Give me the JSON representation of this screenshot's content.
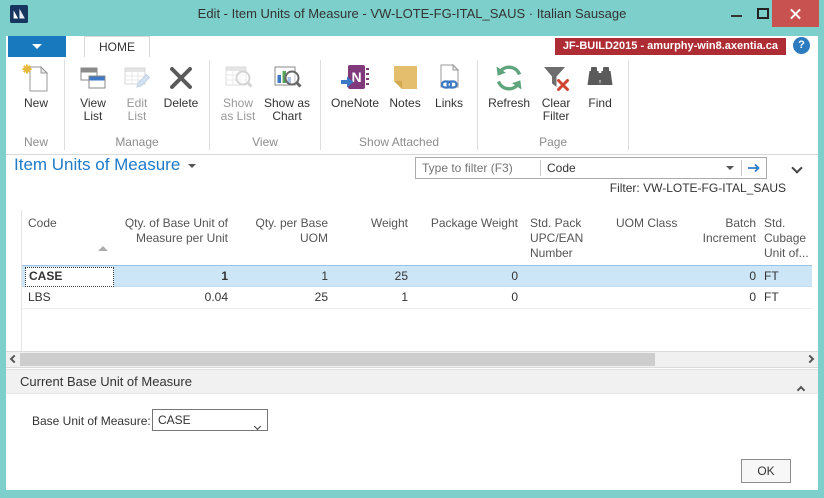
{
  "window": {
    "title": "Edit - Item Units of Measure - VW-LOTE-FG-ITAL_SAUS · Italian Sausage"
  },
  "tabbar": {
    "home_tab": "HOME",
    "server_badge": "JF-BUILD2015 - amurphy-win8.axentia.ca",
    "help_glyph": "?"
  },
  "ribbon": {
    "groups": [
      {
        "label": "New",
        "buttons": [
          {
            "label": "New",
            "icon": "new-icon",
            "enabled": true
          }
        ]
      },
      {
        "label": "Manage",
        "buttons": [
          {
            "label": "View\nList",
            "icon": "view-list-icon",
            "enabled": true
          },
          {
            "label": "Edit\nList",
            "icon": "edit-list-icon",
            "enabled": false
          },
          {
            "label": "Delete",
            "icon": "delete-icon",
            "enabled": true
          }
        ]
      },
      {
        "label": "View",
        "buttons": [
          {
            "label": "Show\nas List",
            "icon": "show-as-list-icon",
            "enabled": false
          },
          {
            "label": "Show as\nChart",
            "icon": "show-as-chart-icon",
            "enabled": true
          }
        ]
      },
      {
        "label": "Show Attached",
        "buttons": [
          {
            "label": "OneNote",
            "icon": "onenote-icon",
            "enabled": true
          },
          {
            "label": "Notes",
            "icon": "notes-icon",
            "enabled": true
          },
          {
            "label": "Links",
            "icon": "links-icon",
            "enabled": true
          }
        ]
      },
      {
        "label": "Page",
        "buttons": [
          {
            "label": "Refresh",
            "icon": "refresh-icon",
            "enabled": true
          },
          {
            "label": "Clear\nFilter",
            "icon": "clear-filter-icon",
            "enabled": true
          },
          {
            "label": "Find",
            "icon": "find-icon",
            "enabled": true
          }
        ]
      }
    ]
  },
  "toolbar": {
    "page_title": "Item Units of Measure",
    "filter_placeholder": "Type to filter (F3)",
    "filter_column": "Code",
    "filter_label": "Filter: VW-LOTE-FG-ITAL_SAUS"
  },
  "grid": {
    "columns": [
      {
        "label": "Code",
        "align": "left",
        "sorted": "asc"
      },
      {
        "label": "Qty. of Base Unit of Measure per Unit",
        "align": "right"
      },
      {
        "label": "Qty. per Base UOM",
        "align": "right"
      },
      {
        "label": "Weight",
        "align": "right"
      },
      {
        "label": "Package Weight",
        "align": "right"
      },
      {
        "label": "Std. Pack UPC/EAN Number",
        "align": "left"
      },
      {
        "label": "UOM Class",
        "align": "left"
      },
      {
        "label": "Batch Increment",
        "align": "right"
      },
      {
        "label": "Std. Cubage Unit of...",
        "align": "left"
      }
    ],
    "rows": [
      {
        "cells": [
          "CASE",
          "1",
          "1",
          "25",
          "0",
          "",
          "",
          "0",
          "FT"
        ],
        "selected": true,
        "focus_cell": 0,
        "bold_cells": [
          0,
          1
        ]
      },
      {
        "cells": [
          "LBS",
          "0.04",
          "25",
          "1",
          "0",
          "",
          "",
          "0",
          "FT"
        ],
        "selected": false,
        "focus_cell": -1,
        "bold_cells": []
      }
    ]
  },
  "fasttab": {
    "title": "Current Base Unit of Measure",
    "field_label": "Base Unit of Measure:",
    "field_value": "CASE"
  },
  "footer": {
    "ok_label": "OK"
  },
  "colors": {
    "window_teal": "#7CCFCA",
    "badge_red": "#AE2C33",
    "close_red": "#C85250",
    "appmenu_blue": "#1879BF",
    "title_link_blue": "#1E7AC9",
    "selection_blue": "#CDE6F7",
    "onenote_purple": "#80397B",
    "refresh_green": "#5FA57D"
  }
}
